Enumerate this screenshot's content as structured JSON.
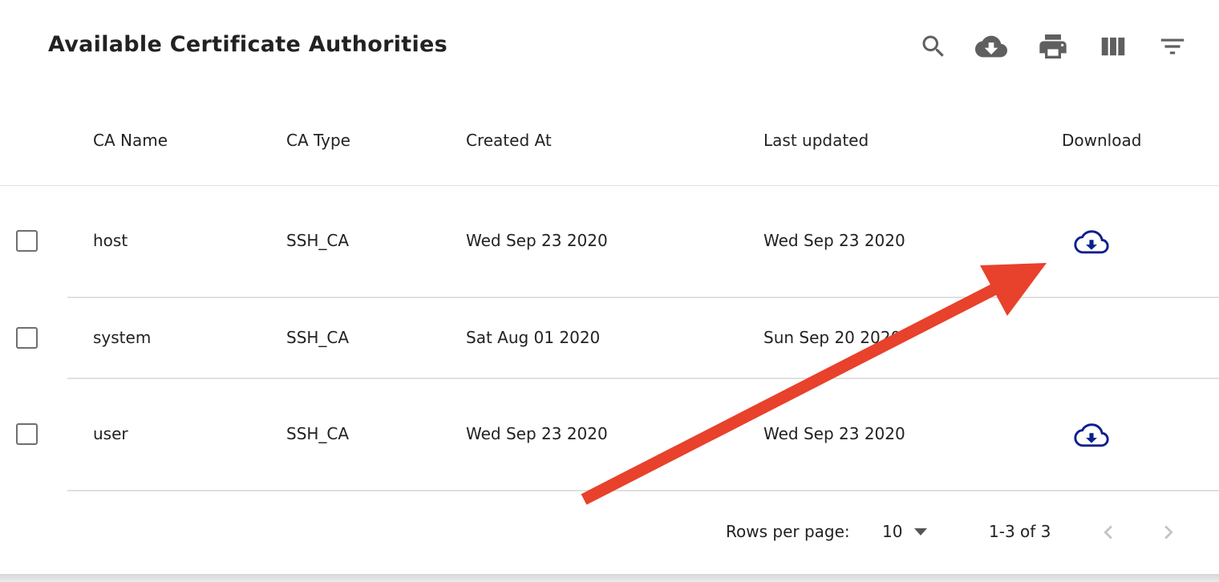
{
  "title": "Available Certificate Authorities",
  "toolbar": {
    "icons": [
      "search-icon",
      "cloud-download-icon",
      "print-icon",
      "view-columns-icon",
      "filter-icon"
    ],
    "icon_color": "#5f5f5f"
  },
  "table": {
    "columns": [
      "CA Name",
      "CA Type",
      "Created At",
      "Last updated",
      "Download"
    ],
    "rows": [
      {
        "name": "host",
        "type": "SSH_CA",
        "created": "Wed Sep 23 2020",
        "updated": "Wed Sep 23 2020",
        "download": true
      },
      {
        "name": "system",
        "type": "SSH_CA",
        "created": "Sat Aug 01 2020",
        "updated": "Sun Sep 20 2020",
        "download": false
      },
      {
        "name": "user",
        "type": "SSH_CA",
        "created": "Wed Sep 23 2020",
        "updated": "Wed Sep 23 2020",
        "download": true
      }
    ],
    "download_icon_color": "#0d1f8c"
  },
  "pagination": {
    "rows_per_page_label": "Rows per page:",
    "rows_per_page_value": "10",
    "range_text": "1-3 of 3"
  },
  "annotation": {
    "arrow_color": "#e8412c"
  }
}
